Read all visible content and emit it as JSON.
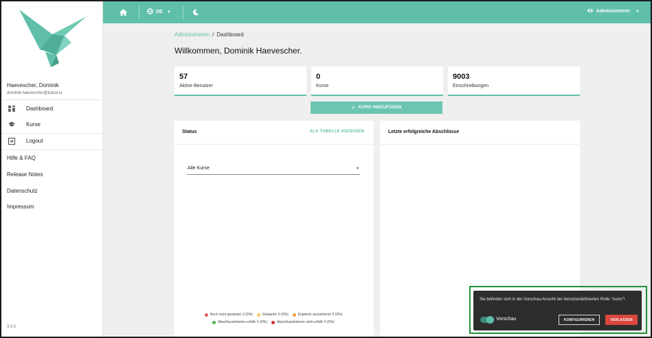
{
  "sidebar": {
    "user_name": "Haevescher, Dominik",
    "user_email": "dominik.haevescher@tutool.io",
    "nav": [
      {
        "label": "Dashboard",
        "icon": "dashboard-icon"
      },
      {
        "label": "Kurse",
        "icon": "graduation-cap-icon"
      },
      {
        "label": "Logout",
        "icon": "logout-icon"
      }
    ],
    "links": [
      "Hilfe & FAQ",
      "Release Notes",
      "Datenschutz",
      "Impressum"
    ],
    "version": "3.3.0"
  },
  "topbar": {
    "home_icon": "home-icon",
    "language_icon": "globe-icon",
    "language": "DE",
    "theme_icon": "moon-icon",
    "role_icon": "eye-icon",
    "role": "Administrieren"
  },
  "breadcrumb": {
    "parent": "Administrieren",
    "separator": "/",
    "current": "Dashboard"
  },
  "page_title": "Willkommen, Dominik Haevescher.",
  "stats": [
    {
      "value": "57",
      "label": "Aktive Benutzer"
    },
    {
      "value": "0",
      "label": "Kurse"
    },
    {
      "value": "9003",
      "label": "Einschreibungen"
    }
  ],
  "add_course_button": "KURS HINZUFÜGEN",
  "status_panel": {
    "title": "Status",
    "action": "ALS TABELLE ANZEIGEN",
    "select_value": "Alle Kurse",
    "legend_row1": [
      {
        "label": "Noch nicht gestartet: 0 (0%)",
        "color": "#e8575a"
      },
      {
        "label": "Gestartet: 0 (0%)",
        "color": "#f2c55c"
      },
      {
        "label": "Ergebnis ausstehend: 0 (0%)",
        "color": "#f0a030"
      }
    ],
    "legend_row2": [
      {
        "label": "Abschlusskriterien erfüllt: 0 (0%)",
        "color": "#4caf50"
      },
      {
        "label": "Abschlusskriterien nicht erfüllt: 0 (0%)",
        "color": "#d32f2f"
      }
    ]
  },
  "completions_panel": {
    "title": "Letzte erfolgreiche Abschlüsse"
  },
  "preview_dialog": {
    "message": "Sie befinden sich in der Vorschau-Ansicht der benutzerdefinierten Rolle \"Autor\"!",
    "toggle_label": "Vorschau",
    "configure_button": "KONFIGURIEREN",
    "leave_button": "VERLASSEN"
  },
  "colors": {
    "accent": "#5fbfa9",
    "danger": "#d9473f",
    "highlight": "#1f8f3a"
  }
}
